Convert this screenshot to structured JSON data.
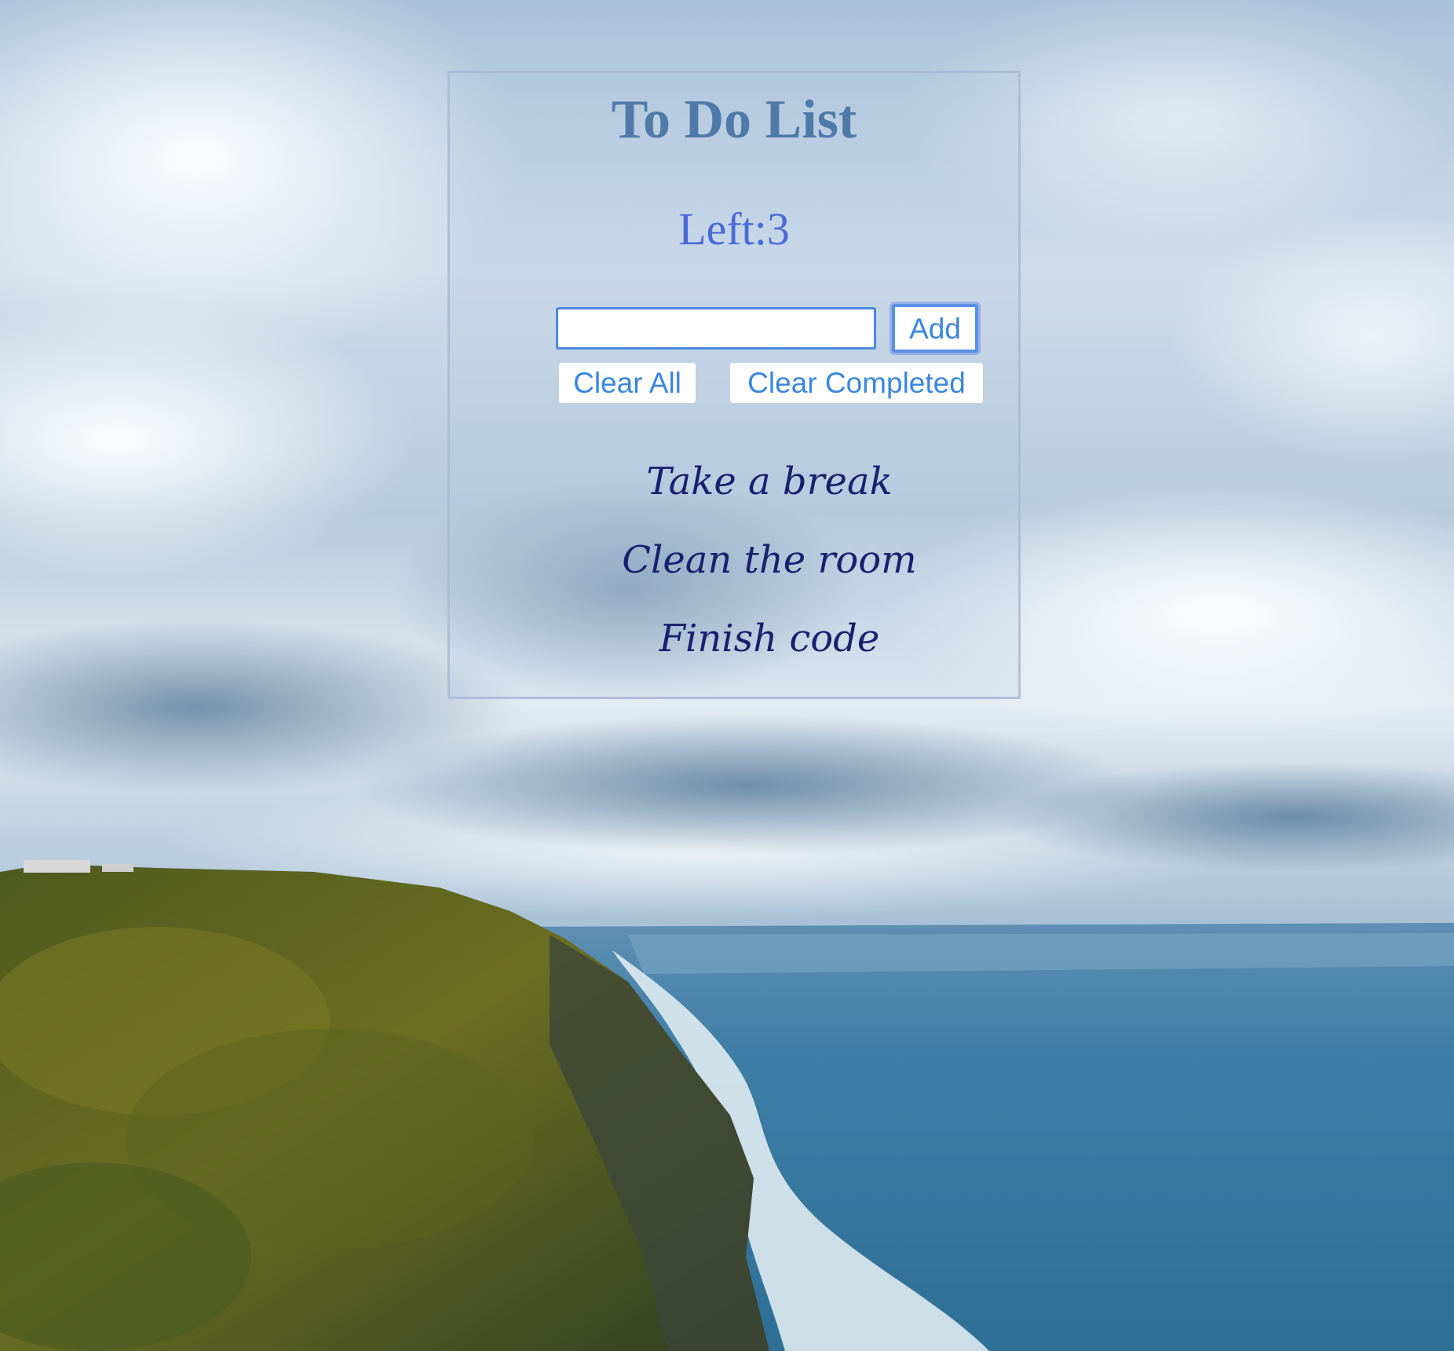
{
  "app": {
    "title": "To Do List",
    "left_label": "Left:3"
  },
  "form": {
    "input_value": "",
    "input_placeholder": "",
    "add_label": "Add",
    "clear_all_label": "Clear All",
    "clear_completed_label": "Clear Completed"
  },
  "tasks": [
    {
      "text": "Take a break"
    },
    {
      "text": "Clean the room"
    },
    {
      "text": "Finish code"
    }
  ],
  "colors": {
    "title": "#4f7aa8",
    "counter": "#4a6ad8",
    "button_text": "#3b86df",
    "task_text": "#1a1f6e",
    "input_border": "#4a8ae0"
  },
  "background": {
    "icon": "landscape-photo-icon",
    "description_visible": false
  }
}
